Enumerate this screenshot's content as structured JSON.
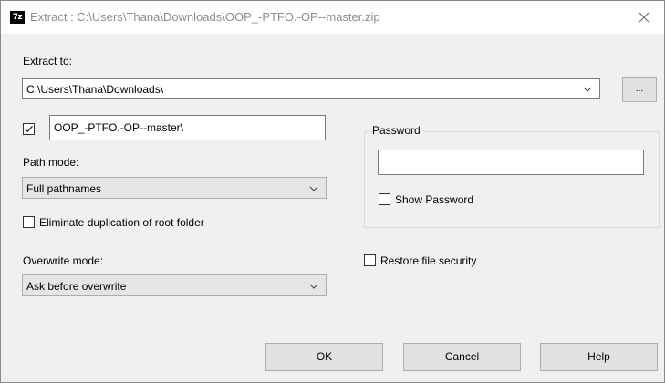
{
  "window": {
    "title": "Extract : C:\\Users\\Thana\\Downloads\\OOP_-PTFO.-OP--master.zip",
    "app_icon_text": "7z"
  },
  "extract_to": {
    "label": "Extract to:",
    "value": "C:\\Users\\Thana\\Downloads\\",
    "browse_label": "..."
  },
  "subfolder": {
    "checked": true,
    "value": "OOP_-PTFO.-OP--master\\"
  },
  "path_mode": {
    "label": "Path mode:",
    "value": "Full pathnames"
  },
  "eliminate_duplication": {
    "label": "Eliminate duplication of root folder",
    "checked": false
  },
  "overwrite_mode": {
    "label": "Overwrite mode:",
    "value": "Ask before overwrite"
  },
  "password": {
    "group_label": "Password",
    "value": "",
    "show_password_label": "Show Password",
    "show_password_checked": false
  },
  "restore_security": {
    "label": "Restore file security",
    "checked": false
  },
  "buttons": {
    "ok": "OK",
    "cancel": "Cancel",
    "help": "Help"
  },
  "icons": {
    "close": "close-icon",
    "dropdown": "chevron-down-icon",
    "check": "checkmark-icon"
  }
}
